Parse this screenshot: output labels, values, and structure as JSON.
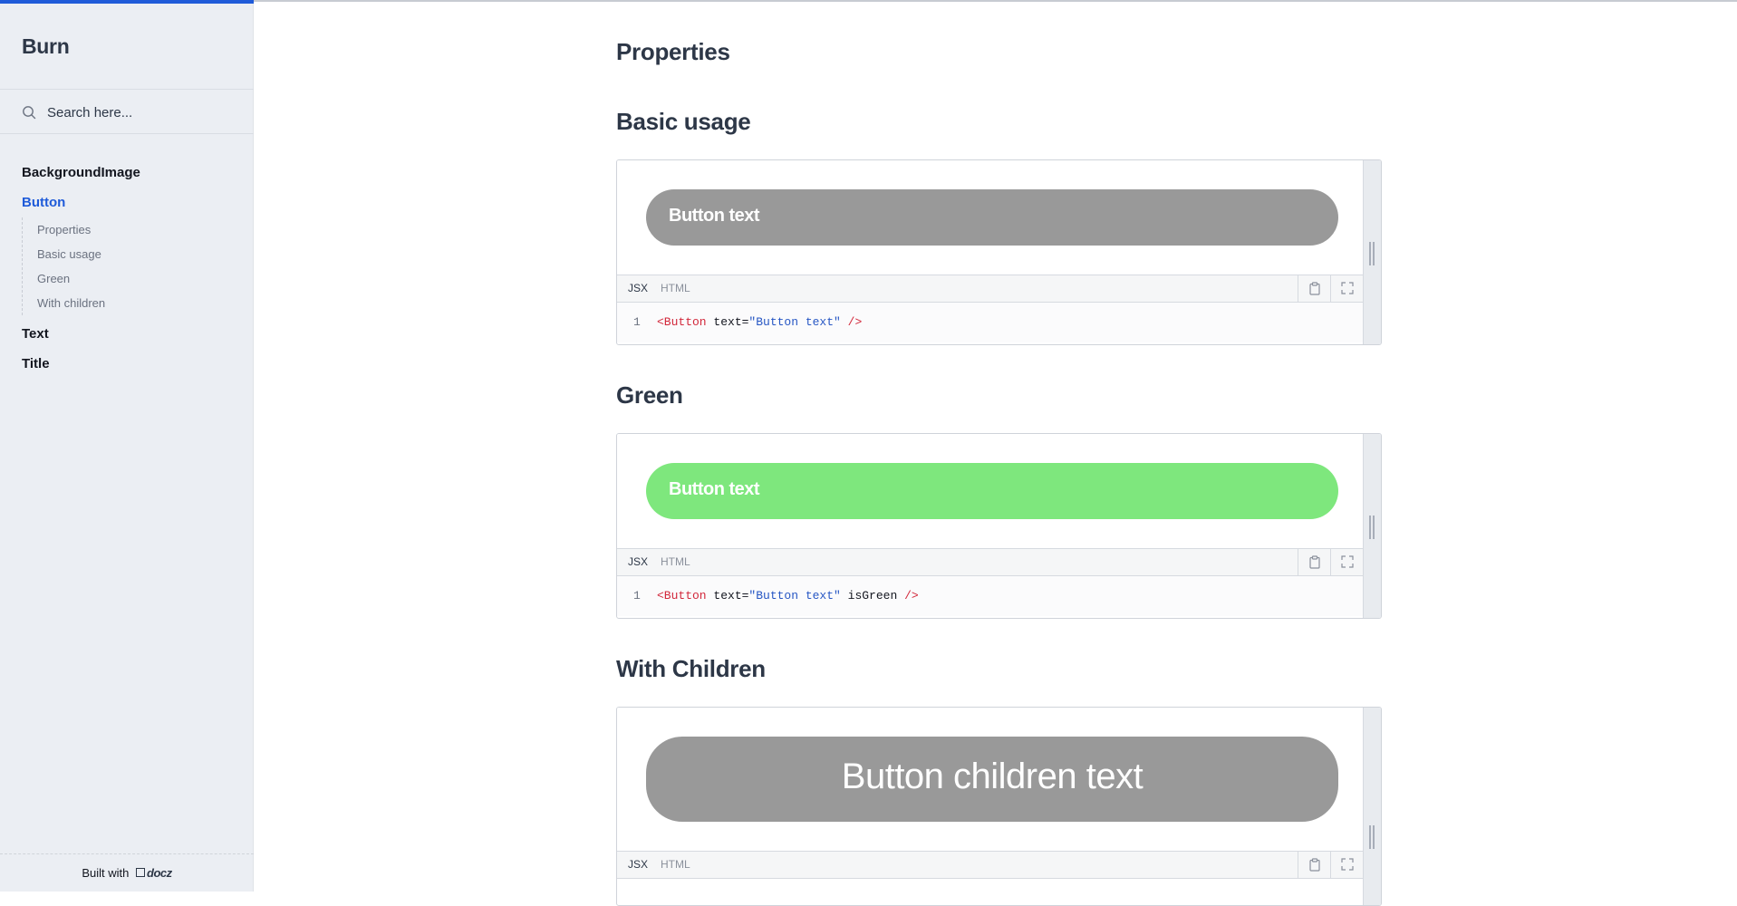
{
  "sidebar": {
    "brand": "Burn",
    "search_placeholder": "Search here...",
    "nav": [
      {
        "label": "BackgroundImage",
        "active": false
      },
      {
        "label": "Button",
        "active": true,
        "children": [
          "Properties",
          "Basic usage",
          "Green",
          "With children"
        ]
      },
      {
        "label": "Text",
        "active": false
      },
      {
        "label": "Title",
        "active": false
      }
    ],
    "footer_prefix": "Built with",
    "footer_brand": "docz"
  },
  "main": {
    "properties_heading": "Properties",
    "sections": [
      {
        "heading": "Basic usage",
        "button_text": "Button text",
        "button_color": "#999999",
        "tabs": [
          "JSX",
          "HTML"
        ],
        "code_line": "1",
        "code_tag_open": "<Button",
        "code_attr": " text=",
        "code_string": "\"Button text\"",
        "code_extra": " ",
        "code_tag_close": "/>"
      },
      {
        "heading": "Green",
        "button_text": "Button text",
        "button_color": "#7ee77d",
        "tabs": [
          "JSX",
          "HTML"
        ],
        "code_line": "1",
        "code_tag_open": "<Button",
        "code_attr": " text=",
        "code_string": "\"Button text\"",
        "code_extra": " isGreen ",
        "code_tag_close": "/>"
      },
      {
        "heading": "With Children",
        "button_text": "Button children text",
        "button_color": "#999999",
        "tabs": [
          "JSX",
          "HTML"
        ]
      }
    ]
  },
  "colors": {
    "accent": "#1f5bd9",
    "sidebar_bg": "#ebeef3",
    "code_tag": "#d2283b",
    "code_string": "#2757c4"
  },
  "icons": {
    "search": "search-icon",
    "copy": "clipboard-icon",
    "fullscreen": "fullscreen-icon"
  }
}
